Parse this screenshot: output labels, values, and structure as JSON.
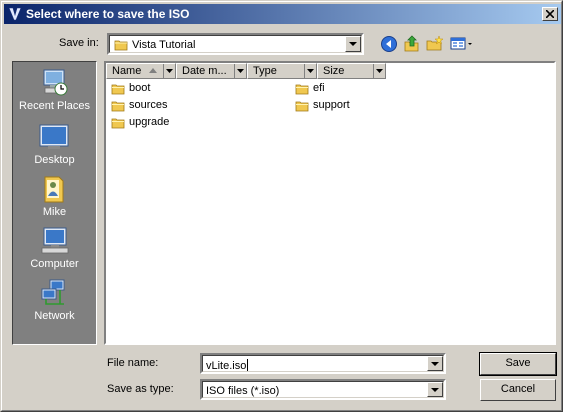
{
  "window": {
    "title": "Select where to save the ISO",
    "app_icon": "vlite-app-icon",
    "close_icon": "close-icon"
  },
  "toolbar": {
    "save_in_label": "Save in:",
    "save_in_value": "Vista Tutorial",
    "buttons": [
      "back-icon",
      "up-folder-icon",
      "new-folder-icon",
      "view-menu-icon"
    ]
  },
  "places": [
    {
      "label": "Recent Places",
      "icon": "recent-places-icon"
    },
    {
      "label": "Desktop",
      "icon": "desktop-icon"
    },
    {
      "label": "Mike",
      "icon": "user-folder-icon"
    },
    {
      "label": "Computer",
      "icon": "computer-icon"
    },
    {
      "label": "Network",
      "icon": "network-icon"
    }
  ],
  "columns": [
    {
      "label": "Name"
    },
    {
      "label": "Date m..."
    },
    {
      "label": "Type"
    },
    {
      "label": "Size"
    }
  ],
  "files": [
    "boot",
    "efi",
    "sources",
    "support",
    "upgrade"
  ],
  "form": {
    "file_name_label": "File name:",
    "file_name_value": "vLite.iso",
    "save_as_type_label": "Save as type:",
    "save_as_type_value": "ISO files (*.iso)"
  },
  "buttons": {
    "save": "Save",
    "cancel": "Cancel"
  },
  "colors": {
    "title_start": "#0a246a",
    "title_end": "#a6caf0",
    "face": "#d4d0c8",
    "places_bg": "#808080",
    "folder": "#f0c850"
  }
}
